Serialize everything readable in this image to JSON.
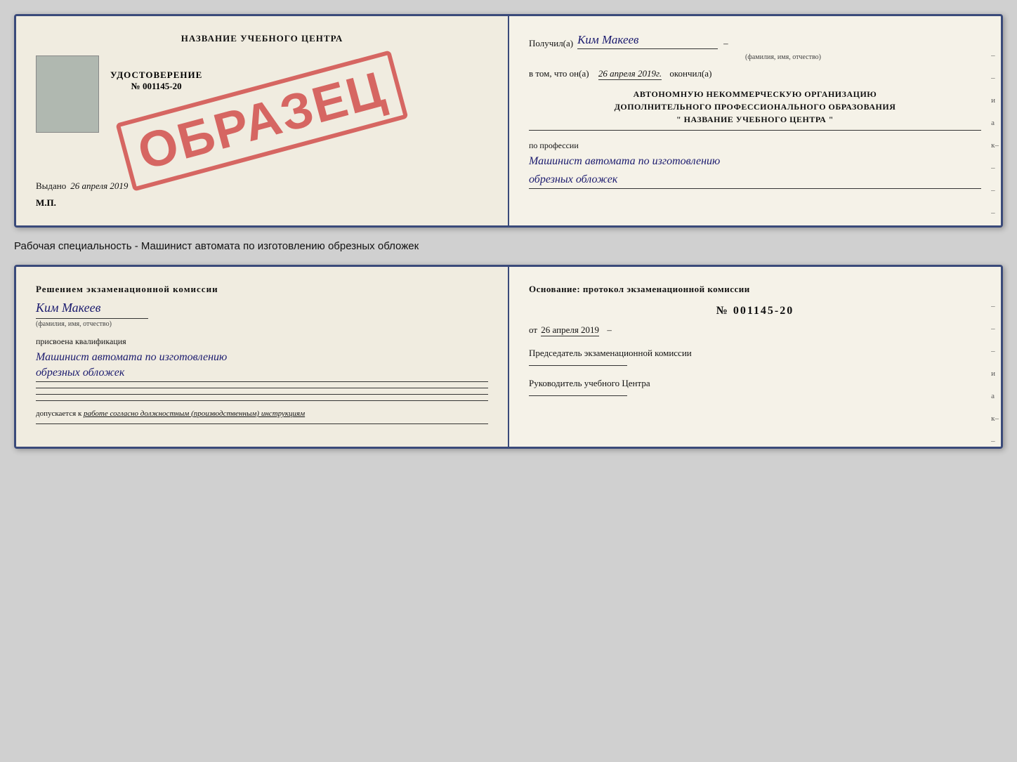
{
  "top_doc": {
    "left": {
      "title": "НАЗВАНИЕ УЧЕБНОГО ЦЕНТРА",
      "stamp": "ОБРАЗЕЦ",
      "udost_label": "УДОСТОВЕРЕНИЕ",
      "udost_number": "№ 001145-20",
      "vydano_prefix": "Выдано",
      "vydano_date": "26 апреля 2019",
      "mp": "М.П."
    },
    "right": {
      "poluchil_label": "Получил(а)",
      "poluchil_value": "Ким Макеев",
      "fio_sub": "(фамилия, имя, отчество)",
      "vtom_label": "в том, что он(а)",
      "vtom_date": "26 апреля 2019г.",
      "okoncil_label": "окончил(а)",
      "org_line1": "АВТОНОМНУЮ НЕКОММЕРЧЕСКУЮ ОРГАНИЗАЦИЮ",
      "org_line2": "ДОПОЛНИТЕЛЬНОГО ПРОФЕССИОНАЛЬНОГО ОБРАЗОВАНИЯ",
      "org_name": "\"  НАЗВАНИЕ УЧЕБНОГО ЦЕНТРА  \"",
      "po_professii_label": "по профессии",
      "profession_line1": "Машинист автомата по изготовлению",
      "profession_line2": "обрезных обложек",
      "side_marks": [
        "–",
        "–",
        "а",
        "к–",
        "–",
        "–",
        "–"
      ]
    }
  },
  "specialty_label": "Рабочая специальность - Машинист автомата по изготовлению обрезных обложек",
  "bottom_doc": {
    "left": {
      "resheniye_text": "Решением экзаменационной комиссии",
      "person_name": "Ким Макеев",
      "fio_sub": "(фамилия, имя, отчество)",
      "prisvoena_text": "присвоена квалификация",
      "kvalif_line1": "Машинист автомата по изготовлению",
      "kvalif_line2": "обрезных обложек",
      "dopuskaetsya_prefix": "допускается к",
      "dopuskaetsya_value": "работе согласно должностным (производственным) инструкциям"
    },
    "right": {
      "osnovanie_text": "Основание: протокол экзаменационной комиссии",
      "protocol_number": "№  001145-20",
      "ot_prefix": "от",
      "protocol_date": "26 апреля 2019",
      "predsedatel_label": "Председатель экзаменационной комиссии",
      "rukovoditel_label": "Руководитель учебного Центра",
      "side_marks": [
        "–",
        "–",
        "–",
        "и",
        "а",
        "к–",
        "–",
        "–",
        "–",
        "–"
      ]
    }
  }
}
